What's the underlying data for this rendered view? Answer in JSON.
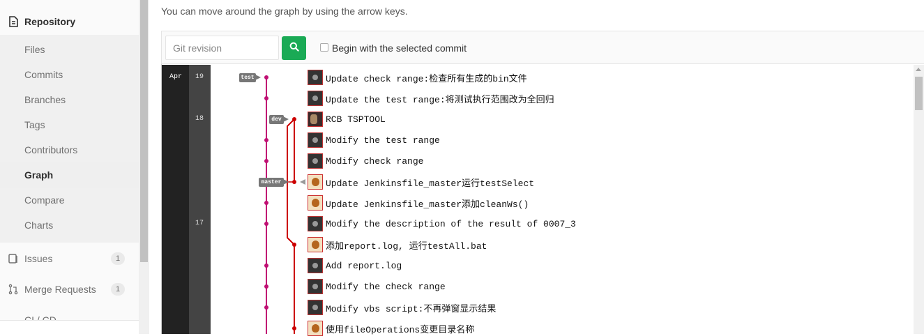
{
  "sidebar": {
    "section": "Repository",
    "items": [
      "Files",
      "Commits",
      "Branches",
      "Tags",
      "Contributors",
      "Graph",
      "Compare",
      "Charts"
    ],
    "active": "Graph",
    "issues": {
      "label": "Issues",
      "count": "1"
    },
    "merge_requests": {
      "label": "Merge Requests",
      "count": "1"
    },
    "cicd": {
      "label": "CI / CD"
    }
  },
  "hint": "You can move around the graph by using the arrow keys.",
  "toolbar": {
    "revision_placeholder": "Git revision",
    "checkbox_label": "Begin with the selected commit",
    "search_icon": "search-icon",
    "button_color": "#1aaa55"
  },
  "graph": {
    "month": "Apr",
    "days": [
      "19",
      "18",
      "17"
    ],
    "branch_color_main": "#c00f73",
    "branch_color_dev": "#c00",
    "tags": [
      "test",
      "dev",
      "master"
    ],
    "commits": [
      "Update check range:检查所有生成的bin文件",
      "Update the test range:将测试执行范围改为全回归",
      "RCB TSPTOOL",
      "Modify the test range",
      "Modify check range",
      "Update Jenkinsfile_master运行testSelect",
      "Update Jenkinsfile_master添加cleanWs()",
      "Modify the description of the result of 0007_3",
      "添加report.log, 运行testAll.bat",
      "Add report.log",
      "Modify the check range",
      "Modify vbs script:不再弹窗显示结果",
      "使用fileOperations变更目录名称"
    ]
  }
}
